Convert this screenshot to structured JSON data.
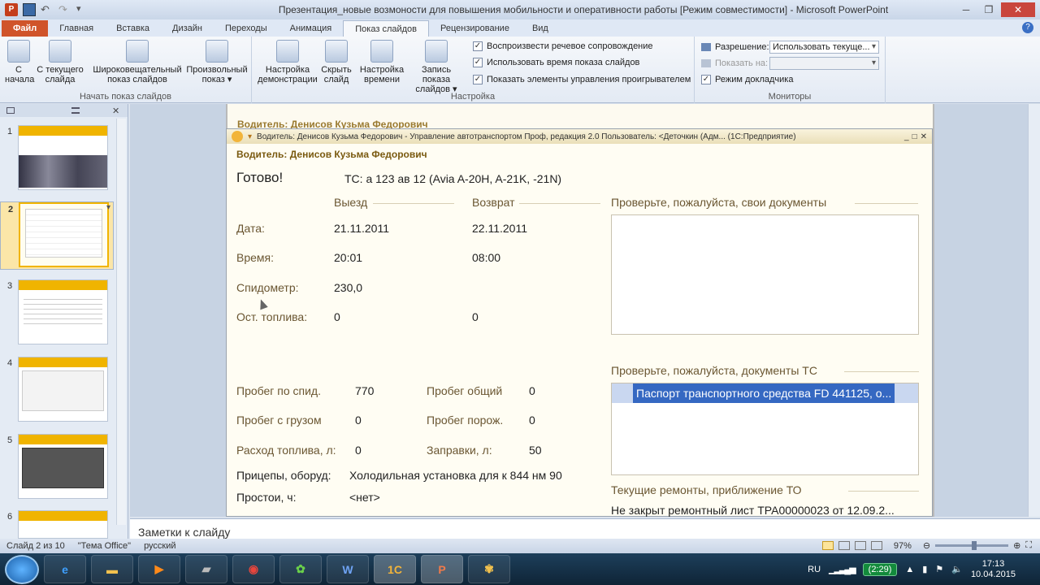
{
  "window": {
    "title": "Презентация_новые возмоности для повышения мобильности и оперативности работы [Режим совместимости] - Microsoft PowerPoint"
  },
  "ribbon_tabs": [
    "Файл",
    "Главная",
    "Вставка",
    "Дизайн",
    "Переходы",
    "Анимация",
    "Показ слайдов",
    "Рецензирование",
    "Вид"
  ],
  "ribbon": {
    "start_group": {
      "label": "Начать показ слайдов",
      "buttons": [
        "С начала",
        "С текущего слайда",
        "Широковещательный показ слайдов",
        "Произвольный показ"
      ]
    },
    "setup_group": {
      "label": "Настройка",
      "buttons": [
        "Настройка демонстрации",
        "Скрыть слайд",
        "Настройка времени",
        "Запись показа слайдов"
      ],
      "checks": [
        "Воспроизвести речевое сопровождение",
        "Использовать время показа слайдов",
        "Показать элементы управления проигрывателем"
      ]
    },
    "monitors_group": {
      "label": "Мониторы",
      "resolution_label": "Разрешение:",
      "resolution_value": "Использовать текуще...",
      "show_on_label": "Показать на:",
      "show_on_value": "",
      "presenter_mode": "Режим докладчика"
    }
  },
  "slides_panel": {
    "numbers": [
      "1",
      "2",
      "3",
      "4",
      "5",
      "6"
    ],
    "selected_index": 2
  },
  "slide": {
    "behind_header": "Водитель: Денисов Кузьма Федорович",
    "window_title": "Водитель: Денисов Кузьма Федорович - Управление автотранспортом Проф, редакция 2.0    Пользователь: <Деточкин (Адм... (1С:Предприятие)",
    "driver_heading": "Водитель: Денисов Кузьма Федорович",
    "ready": "Готово!",
    "vehicle": "ТС: а 123 ав 12 (Avia A-20H, A-21K, -21N)",
    "col_departure": "Выезд",
    "col_return": "Возврат",
    "rows": [
      {
        "label": "Дата:",
        "departure": "21.11.2011",
        "return": "22.11.2011"
      },
      {
        "label": "Время:",
        "departure": "20:01",
        "return": "08:00"
      },
      {
        "label": "Спидометр:",
        "departure": "230,0",
        "return": ""
      },
      {
        "label": "Ост. топлива:",
        "departure": "0",
        "return": "0"
      }
    ],
    "stats": [
      {
        "label": "Пробег по спид.",
        "value": "770",
        "label2": "Пробег общий",
        "value2": "0"
      },
      {
        "label": "Пробег с грузом",
        "value": "0",
        "label2": "Пробег порож.",
        "value2": "0"
      },
      {
        "label": "Расход топлива, л:",
        "value": "0",
        "label2": "Заправки, л:",
        "value2": "50"
      }
    ],
    "trailers_label": "Прицепы, оборуд:",
    "trailers_value": "Холодильная установка для к 844 нм 90",
    "idle_label": "Простои, ч:",
    "idle_value": "<нет>",
    "check_docs": "Проверьте, пожалуйста, свои документы",
    "check_vehicle_docs": "Проверьте, пожалуйста, документы ТС",
    "vehicle_doc_item": "Паспорт транспортного средства FD 441125, о...",
    "current_repairs": "Текущие ремонты, приближение ТО",
    "repair_item": "Не закрыт ремонтный лист ТРА00000023 от 12.09.2..."
  },
  "notes_placeholder": "Заметки к слайду",
  "status": {
    "slide": "Слайд 2 из 10",
    "theme": "\"Тема Office\"",
    "lang": "русский",
    "zoom": "97%"
  },
  "taskbar": {
    "lang": "RU",
    "battery": "(2:29)",
    "time": "17:13",
    "date": "10.04.2015",
    "apps": [
      "explorer",
      "ie",
      "media",
      "terminal",
      "chrome",
      "icq",
      "word",
      "1c",
      "powerpoint",
      "icq2"
    ]
  }
}
